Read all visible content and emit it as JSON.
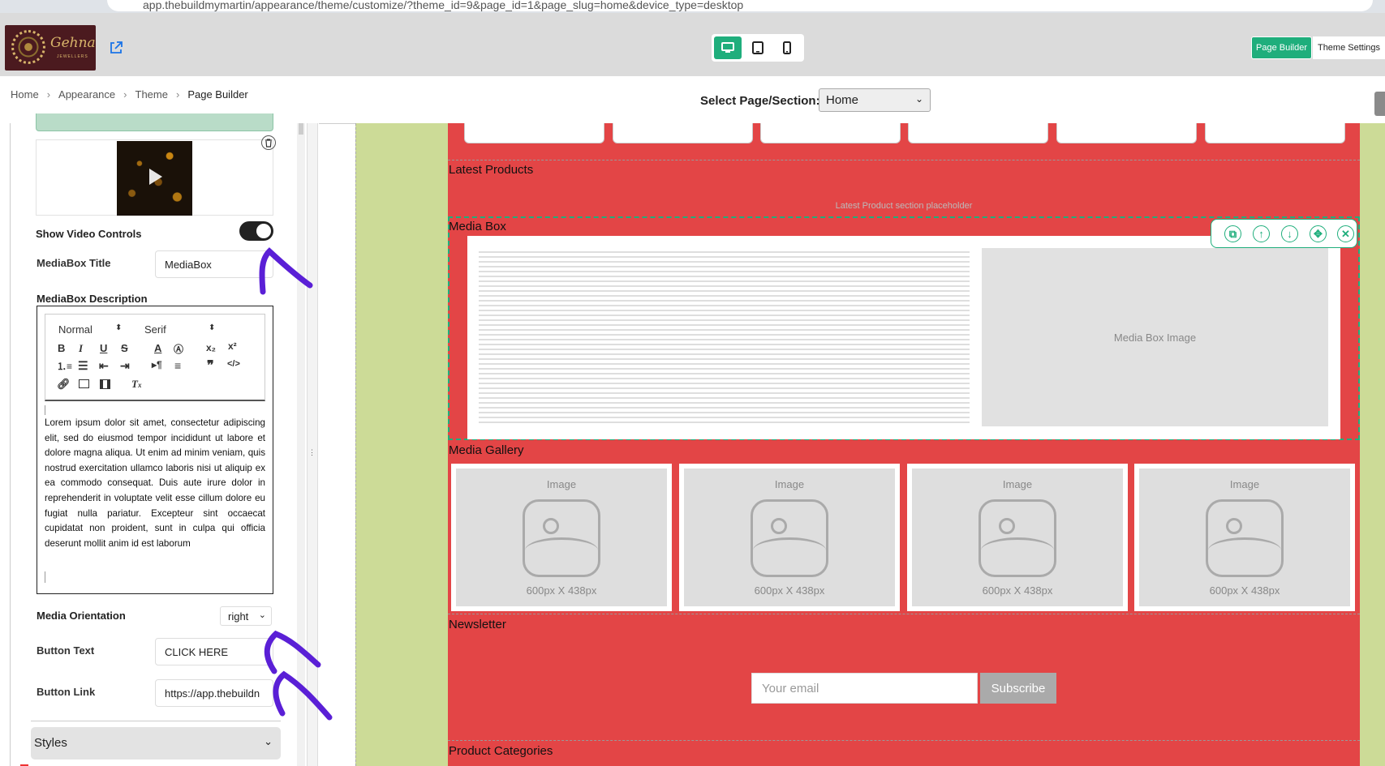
{
  "browser": {
    "url": "app.thebuildmymartin/appearance/theme/customize/?theme_id=9&page_id=1&page_slug=home&device_type=desktop"
  },
  "header": {
    "logo": {
      "name": "Gehna",
      "sub": "JEWELLERS"
    },
    "page_builder_label": "Page Builder",
    "theme_settings_label": "Theme Settings",
    "device_active": "desktop"
  },
  "breadcrumb": [
    "Home",
    "Appearance",
    "Theme",
    "Page Builder"
  ],
  "page_select": {
    "label": "Select Page/Section:",
    "value": "Home"
  },
  "left_panel": {
    "show_video_controls_label": "Show Video Controls",
    "show_video_controls": true,
    "mediabox_title_label": "MediaBox Title",
    "mediabox_title_value": "MediaBox",
    "mediabox_description_label": "MediaBox Description",
    "editor_toolbar": {
      "format": "Normal",
      "font": "Serif"
    },
    "description_text": "Lorem ipsum dolor sit amet, consectetur adipiscing elit, sed do eiusmod tempor incididunt ut labore et dolore magna aliqua. Ut enim ad minim veniam, quis nostrud exercitation ullamco laboris nisi ut aliquip ex ea commodo consequat. Duis aute irure dolor in reprehenderit in voluptate velit esse cillum dolore eu fugiat nulla pariatur. Excepteur sint occaecat cupidatat non proident, sunt in culpa qui officia deserunt mollit anim id est laborum",
    "media_orientation_label": "Media Orientation",
    "media_orientation_value": "right",
    "button_text_label": "Button Text",
    "button_text_value": "CLICK HERE",
    "button_link_label": "Button Link",
    "button_link_value": "https://app.thebuildn",
    "styles_label": "Styles"
  },
  "canvas": {
    "latest_products_title": "Latest Products",
    "latest_products_placeholder": "Latest Product section placeholder",
    "media_box_title": "Media Box",
    "media_box_image": "Media Box Image",
    "media_gallery_title": "Media Gallery",
    "gallery": [
      {
        "top": "Image",
        "bottom": "600px X 438px"
      },
      {
        "top": "Image",
        "bottom": "600px X 438px"
      },
      {
        "top": "Image",
        "bottom": "600px X 438px"
      },
      {
        "top": "Image",
        "bottom": "600px X 438px"
      }
    ],
    "newsletter_title": "Newsletter",
    "email_placeholder": "Your email",
    "subscribe_label": "Subscribe",
    "product_categories_title": "Product Categories"
  },
  "colors": {
    "accent": "#1fae7c",
    "section_bg": "#e34546",
    "page_bg": "#ccdb97",
    "annotation": "#5a1fd6"
  }
}
